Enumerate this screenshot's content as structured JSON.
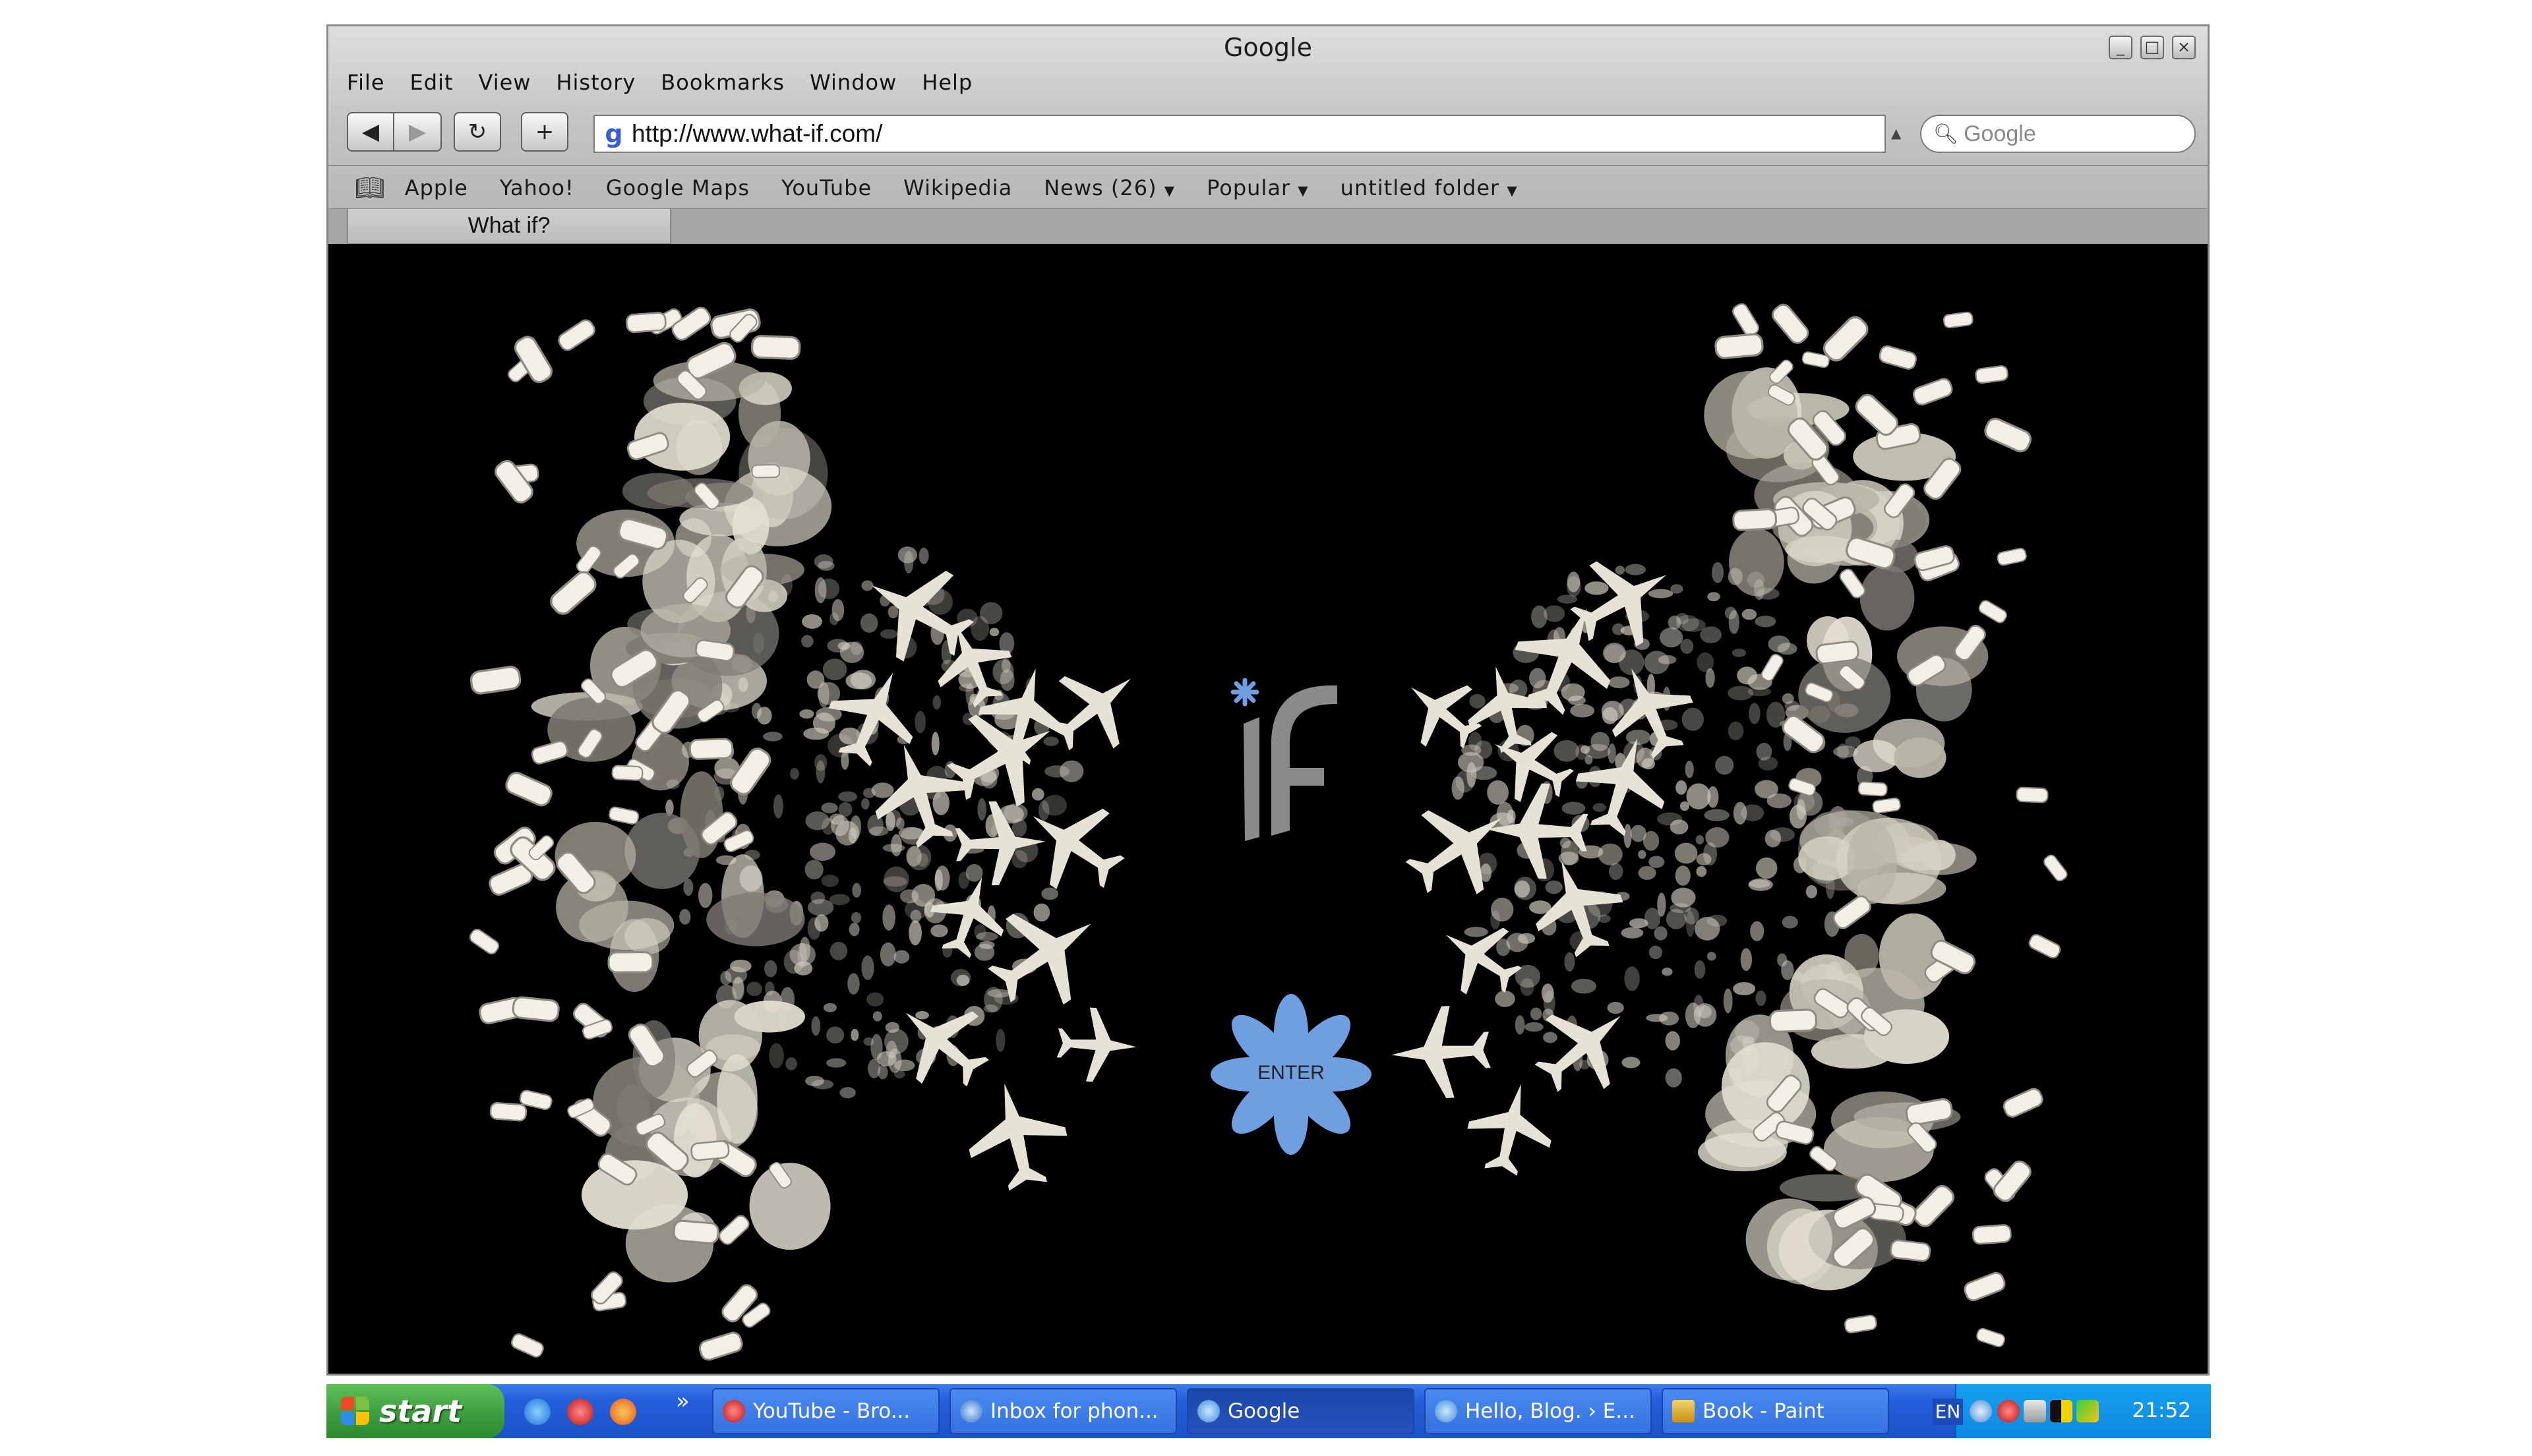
{
  "window": {
    "title": "Google",
    "menu": [
      "File",
      "Edit",
      "View",
      "History",
      "Bookmarks",
      "Window",
      "Help"
    ],
    "address_bar": {
      "url": "http://www.what-if.com/"
    },
    "search": {
      "placeholder": "Google"
    },
    "bookmarks": [
      {
        "label": "Apple",
        "icon": null
      },
      {
        "label": "Yahoo!",
        "icon": null
      },
      {
        "label": "Google Maps",
        "icon": null
      },
      {
        "label": "YouTube",
        "icon": null
      },
      {
        "label": "Wikipedia",
        "icon": null
      },
      {
        "label": "News (26)",
        "icon": "dropdown-arrow"
      },
      {
        "label": "Popular",
        "icon": "dropdown-arrow"
      },
      {
        "label": "untitled folder",
        "icon": "dropdown-arrow"
      }
    ],
    "tab": {
      "label": "What if?"
    }
  },
  "page": {
    "background": "#000000",
    "logo_text": "iF",
    "logo_color": "#8a8a8a",
    "accent_color": "#6f9fe0",
    "enter_button": {
      "label": "ENTER"
    },
    "art_color": "#e6e2d6"
  },
  "taskbar": {
    "start_label": "start",
    "tasks": [
      {
        "label": "YouTube - Bro...",
        "icon": "opera-icon",
        "active": false
      },
      {
        "label": "Inbox for phon...",
        "icon": "thunderbird-icon",
        "active": false
      },
      {
        "label": "Google",
        "icon": "safari-icon",
        "active": true
      },
      {
        "label": "Hello, Blog. › E...",
        "icon": "safari-icon",
        "active": false
      },
      {
        "label": "Book - Paint",
        "icon": "paint-icon",
        "active": false
      }
    ],
    "language": "EN",
    "clock": "21:52"
  }
}
